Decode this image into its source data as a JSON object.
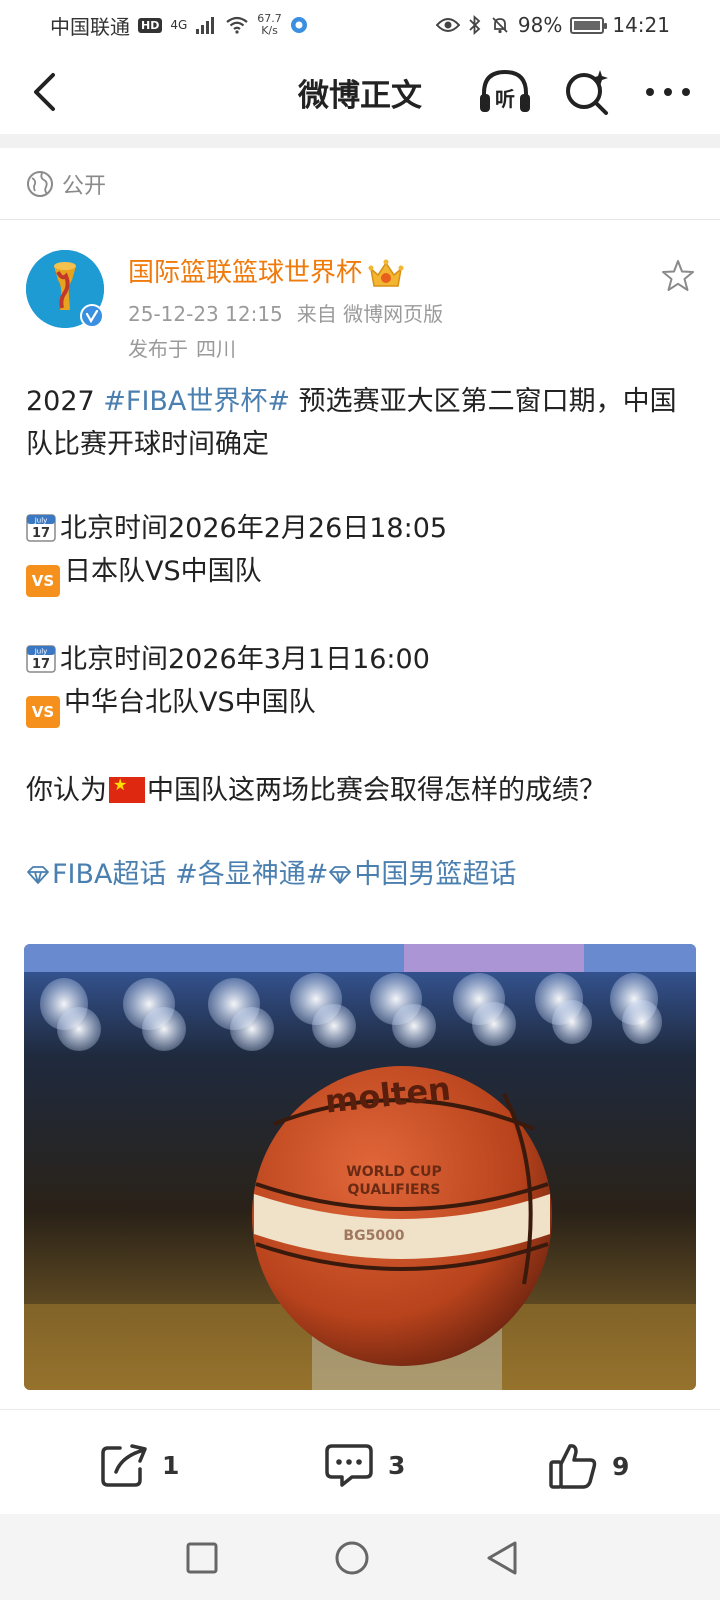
{
  "status_bar": {
    "carrier": "中国联通",
    "hd": "HD",
    "network": "4G",
    "speed_value": "67.7",
    "speed_unit": "K/s",
    "battery": "98%",
    "time": "14:21"
  },
  "nav": {
    "title": "微博正文",
    "listen_label": "听"
  },
  "privacy": {
    "label": "公开"
  },
  "post": {
    "author": "国际篮联篮球世界杯",
    "date": "25-12-23 12:15",
    "source": "来自 微博网页版",
    "location_prefix": "发布于",
    "location": "四川",
    "line1_pre": "2027 ",
    "line1_tag": "#FIBA世界杯#",
    "line1_post": " 预选赛亚大区第二窗口期，中国队比赛开球时间确定",
    "game1_time": "北京时间2026年2月26日18:05",
    "game1_match": "日本队VS中国队",
    "game2_time": "北京时间2026年3月1日16:00",
    "game2_match": "中华台北队VS中国队",
    "question_pre": "你认为",
    "question_post": "中国队这两场比赛会取得怎样的成绩？",
    "tag1": "FIBA超话",
    "tag2": "#各显神通#",
    "tag3": "中国男篮超话",
    "calendar_month": "July",
    "calendar_day": "17",
    "vs_label": "VS",
    "image_text": {
      "brand": "molten",
      "event_line1": "WORLD CUP",
      "event_line2": "QUALIFIERS",
      "model": "BG5000"
    }
  },
  "actions": {
    "share_count": "1",
    "comment_count": "3",
    "like_count": "9"
  },
  "icons": {
    "back": "back-arrow-icon",
    "listen": "headphones-icon",
    "search": "search-icon",
    "more": "more-icon",
    "globe": "globe-icon",
    "star": "star-icon",
    "share": "share-icon",
    "comment": "comment-icon",
    "like": "thumbs-up-icon"
  },
  "colors": {
    "author": "#f07b0d",
    "link": "#4a7fb0",
    "meta": "#9a9a9a"
  }
}
